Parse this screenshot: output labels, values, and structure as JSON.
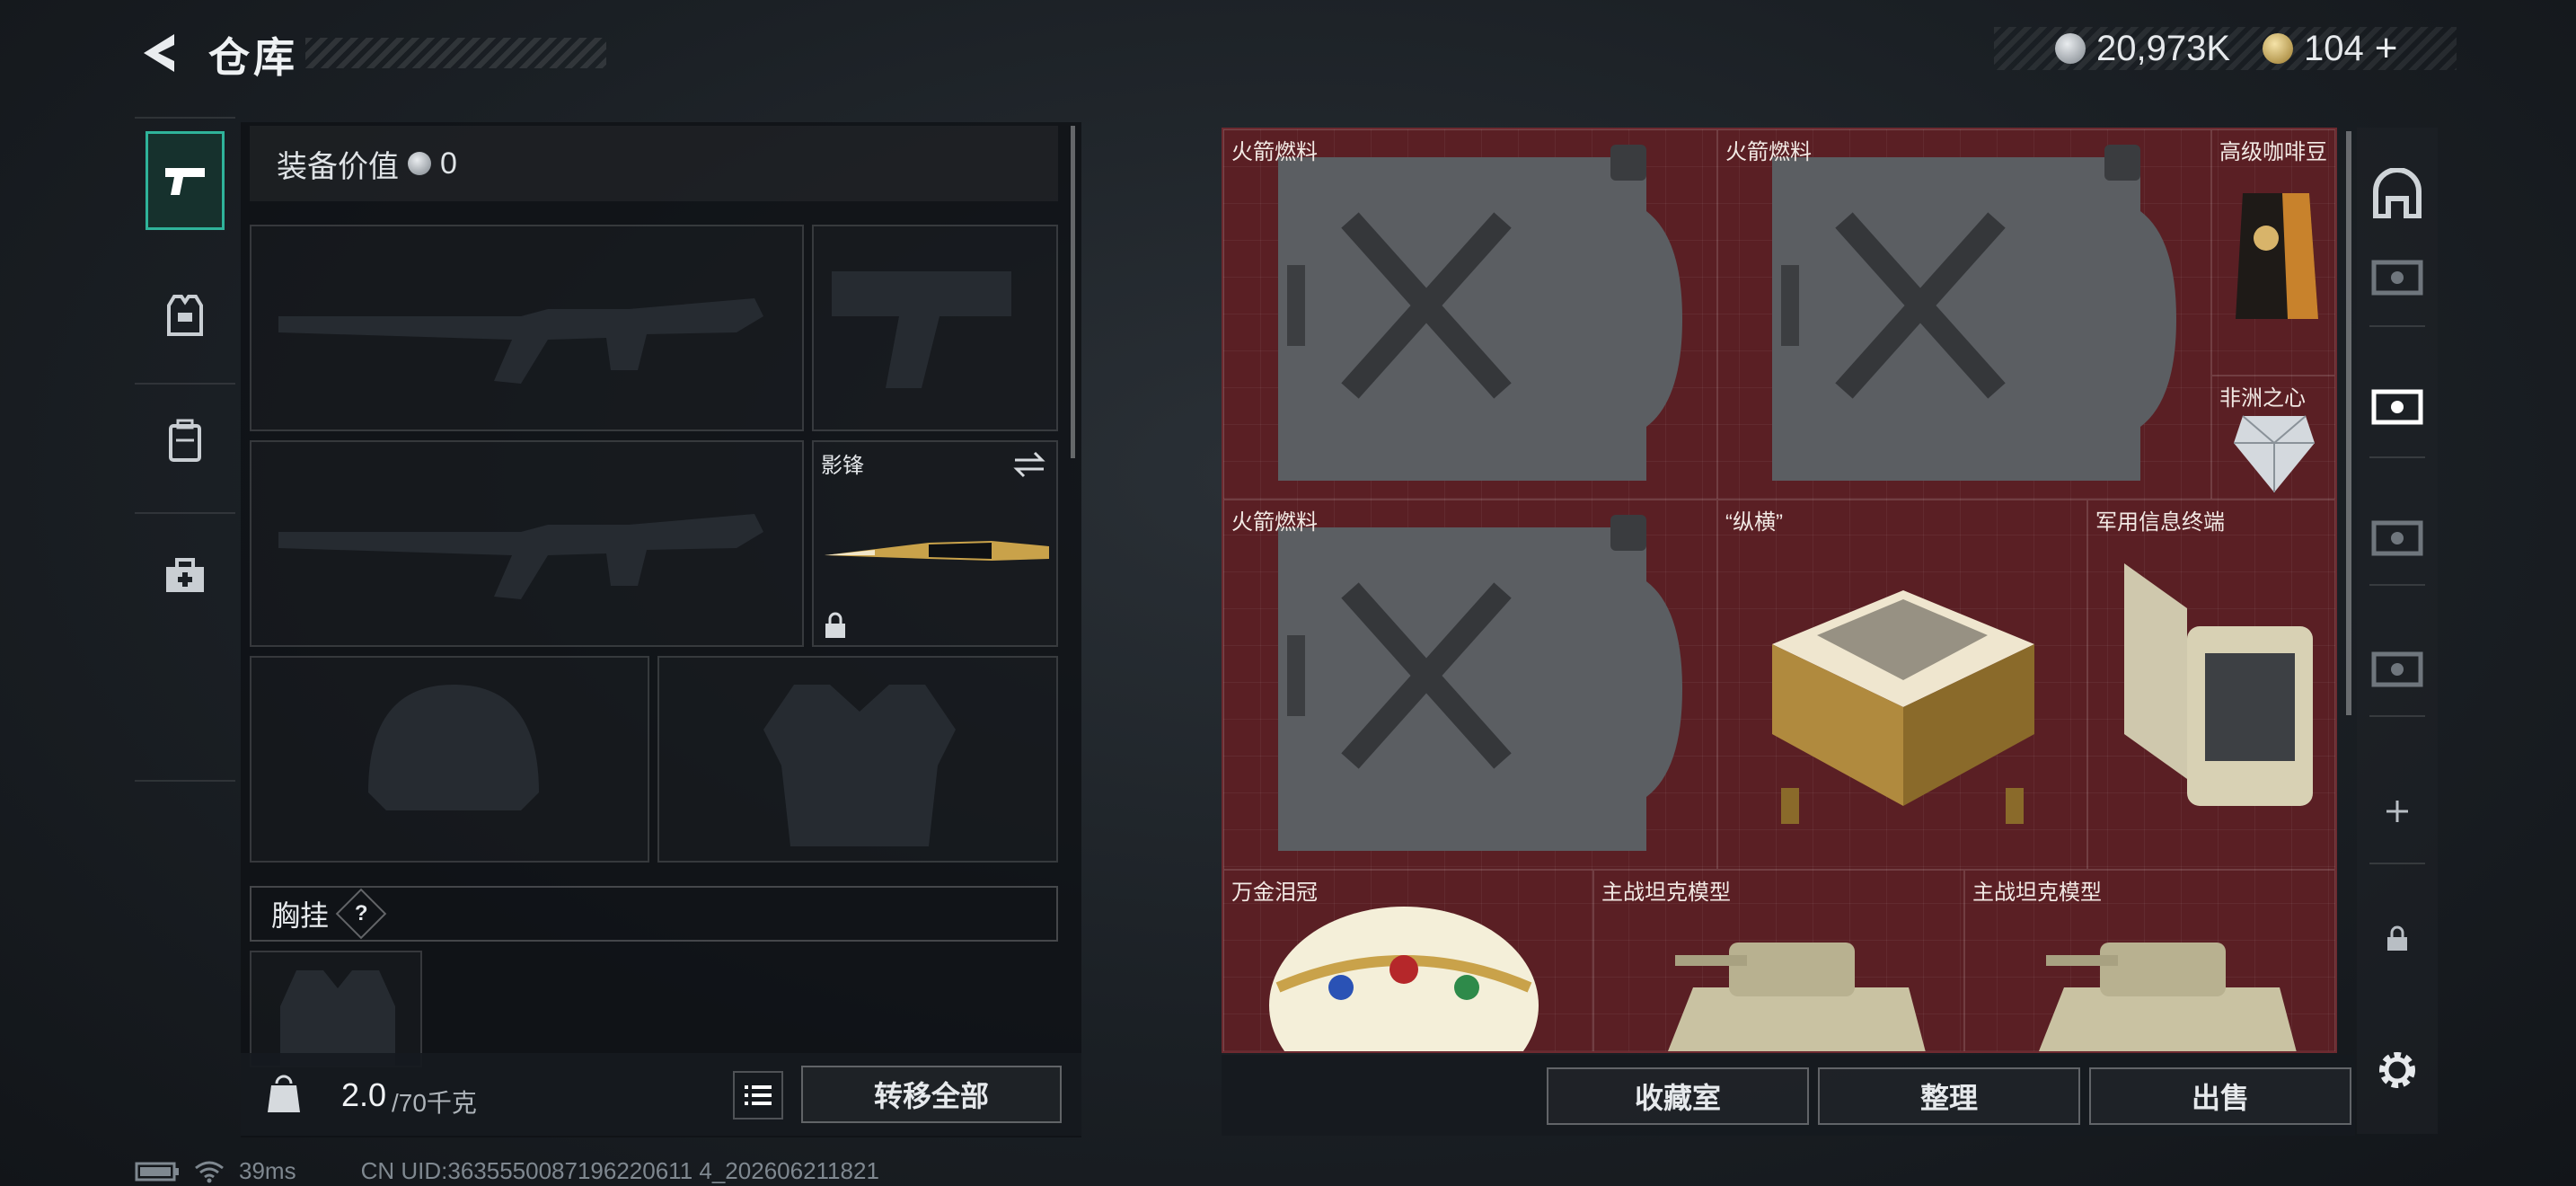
{
  "header": {
    "title": "仓库",
    "currency_silver": "20,973K",
    "currency_gold": "104",
    "currency_plus": "+"
  },
  "equipment": {
    "value_label": "装备价值",
    "value": "0",
    "melee_label": "影锋",
    "chest_label": "胸挂",
    "chest_help": "?"
  },
  "weight": {
    "current": "2.0",
    "max": "/70千克"
  },
  "actions": {
    "transfer_all": "转移全部",
    "collection_room": "收藏室",
    "organize": "整理",
    "sell": "出售"
  },
  "storage": {
    "items": [
      {
        "label": "火箭燃料",
        "icon": "fuel-canister"
      },
      {
        "label": "火箭燃料",
        "icon": "fuel-canister"
      },
      {
        "label": "高级咖啡豆",
        "icon": "coffee-bag"
      },
      {
        "label": "非洲之心",
        "icon": "diamond"
      },
      {
        "label": "火箭燃料",
        "icon": "fuel-canister"
      },
      {
        "label": "“纵横”",
        "icon": "chess-set"
      },
      {
        "label": "军用信息终端",
        "icon": "terminal-case"
      },
      {
        "label": "万金泪冠",
        "icon": "jeweled-crown"
      },
      {
        "label": "主战坦克模型",
        "icon": "tank-model"
      },
      {
        "label": "主战坦克模型",
        "icon": "tank-model"
      }
    ]
  },
  "status": {
    "ping": "39ms",
    "uid": "CN UID:3635550087196220611 4_202606211821"
  },
  "colors": {
    "storage_bg": "#5a1f24",
    "active_tab": "#2fb39a"
  }
}
